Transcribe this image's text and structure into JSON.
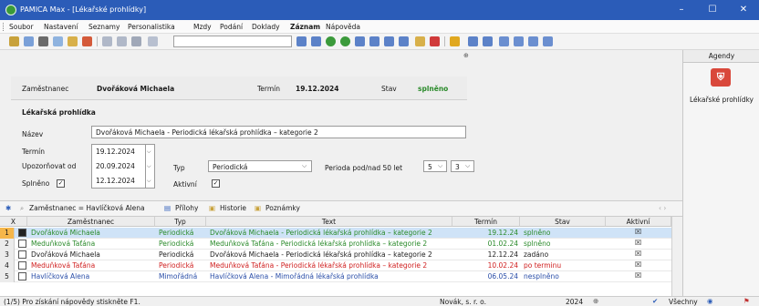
{
  "window": {
    "title": "PAMICA Max - [Lékařské prohlídky]",
    "minimize": "–",
    "maximize": "☐",
    "close": "✕"
  },
  "menu": [
    "Soubor",
    "Nastavení",
    "Seznamy",
    "Personalistika",
    "Mzdy",
    "Podání",
    "Doklady",
    "Záznam",
    "Nápověda"
  ],
  "toolbar": {
    "search_value": ""
  },
  "agendy": {
    "header": "Agendy",
    "item_label": "Lékařské prohlídky"
  },
  "form": {
    "header": {
      "employee_label": "Zaměstnanec",
      "employee_value": "Dvořáková Michaela",
      "term_label": "Termín",
      "term_value": "19.12.2024",
      "state_label": "Stav",
      "state_value": "splněno"
    },
    "section_title": "Lékařská prohlídka",
    "name_label": "Název",
    "name_value": "Dvořáková Michaela - Periodická lékařská prohlídka – kategorie 2",
    "term_label": "Termín",
    "term_value": "19.12.2024",
    "notify_label": "Upozorňovat od",
    "notify_value": "20.09.2024",
    "done_label": "Splněno",
    "done_value": "12.12.2024",
    "type_label": "Typ",
    "type_value": "Periodická",
    "active_label": "Aktivní",
    "period_label": "Perioda pod/nad 50 let",
    "period_under": "5",
    "period_over": "3"
  },
  "tabs": {
    "filter": "Zaměstnanec = Havlíčková Alena",
    "attachments": "Přílohy",
    "history": "Historie",
    "notes": "Poznámky"
  },
  "table": {
    "headers": [
      "X",
      "Zaměstnanec",
      "Typ",
      "Text",
      "Termín",
      "Stav",
      "Aktivní"
    ],
    "rows": [
      {
        "num": "1",
        "employee": "Dvořáková Michaela",
        "type": "Periodická",
        "text": "Dvořáková Michaela - Periodická lékařská prohlídka – kategorie 2",
        "term": "19.12.24",
        "state": "splněno",
        "color": "#2a8a2a"
      },
      {
        "num": "2",
        "employee": "Meduňková Taťána",
        "type": "Periodická",
        "text": "Meduňková Taťána - Periodická lékařská prohlídka – kategorie 2",
        "term": "01.02.24",
        "state": "splněno",
        "color": "#2a8a2a"
      },
      {
        "num": "3",
        "employee": "Dvořáková Michaela",
        "type": "Periodická",
        "text": "Dvořáková Michaela - Periodická lékařská prohlídka – kategorie 2",
        "term": "12.12.24",
        "state": "zadáno",
        "color": "#222222"
      },
      {
        "num": "4",
        "employee": "Meduňková Taťána",
        "type": "Periodická",
        "text": "Meduňková Taťána - Periodická lékařská prohlídka – kategorie 2",
        "term": "10.02.24",
        "state": "po terminu",
        "color": "#d02020"
      },
      {
        "num": "5",
        "employee": "Havlíčková Alena",
        "type": "Mimořádná",
        "text": "Havlíčková Alena - Mimořádná lékařská prohlídka",
        "term": "06.05.24",
        "state": "nesplněno",
        "color": "#2a4ea8"
      }
    ]
  },
  "status": {
    "hint": "(1/5) Pro získání nápovědy stiskněte F1.",
    "company": "Novák, s. r. o.",
    "year": "2024",
    "filter": "Všechny"
  },
  "colors": {
    "titlebar": "#2b5cb8",
    "selected_row": "#cfe3f7",
    "green": "#2a8a2a",
    "red": "#d02020",
    "blue": "#2a4ea8"
  }
}
